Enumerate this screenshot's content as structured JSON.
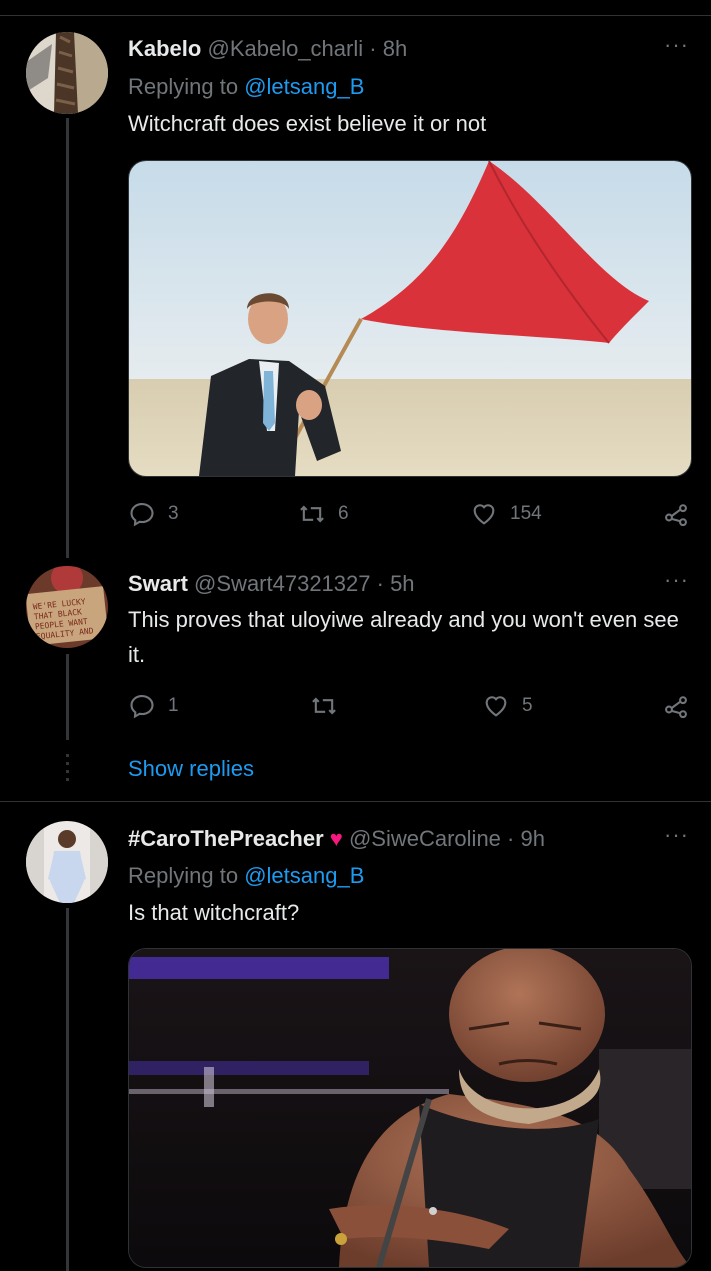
{
  "tweets": [
    {
      "name": "Kabelo",
      "handle": "@Kabelo_charli",
      "time": "· 8h",
      "reply_prefix": "Replying to",
      "reply_mention": "@letsang_B",
      "text": "Witchcraft does exist believe it or not",
      "more": "···",
      "stats": {
        "replies": "3",
        "retweets": "6",
        "likes": "154"
      }
    },
    {
      "name": "Swart",
      "handle": "@Swart47321327",
      "time": "· 5h",
      "text": "This proves that uloyiwe already and you won't even see it.",
      "more": "···",
      "stats": {
        "replies": "1",
        "retweets": "",
        "likes": "5"
      }
    },
    {
      "name": "#CaroThePreacher",
      "name_emoji": "♥",
      "handle": "@SiweCaroline",
      "time": "· 9h",
      "reply_prefix": "Replying to",
      "reply_mention": "@letsang_B",
      "text": "Is that witchcraft?",
      "more": "···"
    }
  ],
  "thread": {
    "show_replies": "Show replies"
  },
  "icons": {
    "reply": "reply-icon",
    "retweet": "retweet-icon",
    "like": "heart-icon",
    "share": "share-icon",
    "more": "more-icon"
  },
  "colors": {
    "background": "#000000",
    "link": "#1d9bf0",
    "muted": "#71767b",
    "heart": "#f91880"
  }
}
